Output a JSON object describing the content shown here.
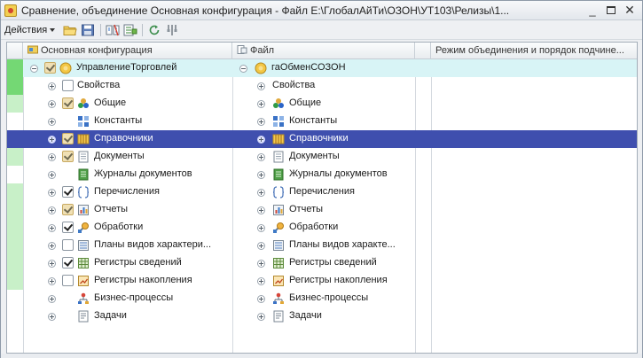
{
  "window": {
    "title": "Сравнение, объединение Основная конфигурация - Файл E:\\ГлобалАйТи\\ОЗОН\\УТ103\\Релизы\\1...",
    "minimize_label": "_",
    "close_label": "✕"
  },
  "toolbar": {
    "actions_label": "Действия",
    "icons": [
      "folder-open-icon",
      "save-icon",
      "compare-icon",
      "filter-icon",
      "refresh-icon",
      "settings-icon"
    ]
  },
  "columns": {
    "main": "Основная конфигурация",
    "file": "Файл",
    "mode": "Режим объединения и порядок подчине..."
  },
  "colors": {
    "selection": "#3f4fae",
    "root_row": "#d8f4f6",
    "changed_marker": "#74d874"
  },
  "rows": [
    {
      "left": "УправлениеТорговлей",
      "right": "гаОбменСОЗОН",
      "icon": "config-root-icon",
      "check": "gray",
      "marker": "strong",
      "level": 0,
      "expander": "minus"
    },
    {
      "left": "Свойства",
      "right": "Свойства",
      "icon": "",
      "check": "off",
      "marker": "strong",
      "level": 1,
      "expander": "plus"
    },
    {
      "left": "Общие",
      "right": "Общие",
      "icon": "common-icon",
      "check": "gray",
      "marker": "light",
      "level": 1,
      "expander": "plus"
    },
    {
      "left": "Константы",
      "right": "Константы",
      "icon": "constants-icon",
      "check": "none",
      "marker": "none",
      "level": 1,
      "expander": "plus"
    },
    {
      "left": "Справочники",
      "right": "Справочники",
      "icon": "catalogs-icon",
      "check": "gray",
      "marker": "none",
      "level": 1,
      "expander": "plus",
      "selected": true
    },
    {
      "left": "Документы",
      "right": "Документы",
      "icon": "documents-icon",
      "check": "gray",
      "marker": "light",
      "level": 1,
      "expander": "plus"
    },
    {
      "left": "Журналы документов",
      "right": "Журналы документов",
      "icon": "journals-icon",
      "check": "none",
      "marker": "none",
      "level": 1,
      "expander": "plus"
    },
    {
      "left": "Перечисления",
      "right": "Перечисления",
      "icon": "enums-icon",
      "check": "on",
      "marker": "light",
      "level": 1,
      "expander": "plus"
    },
    {
      "left": "Отчеты",
      "right": "Отчеты",
      "icon": "reports-icon",
      "check": "gray",
      "marker": "light",
      "level": 1,
      "expander": "plus"
    },
    {
      "left": "Обработки",
      "right": "Обработки",
      "icon": "processing-icon",
      "check": "on",
      "marker": "light",
      "level": 1,
      "expander": "plus"
    },
    {
      "left": "Планы видов характери...",
      "right": "Планы видов характе...",
      "icon": "chart-types-icon",
      "check": "off",
      "marker": "light",
      "level": 1,
      "expander": "plus"
    },
    {
      "left": "Регистры сведений",
      "right": "Регистры сведений",
      "icon": "info-registers-icon",
      "check": "on",
      "marker": "light",
      "level": 1,
      "expander": "plus"
    },
    {
      "left": "Регистры накопления",
      "right": "Регистры накопления",
      "icon": "accum-registers-icon",
      "check": "off",
      "marker": "light",
      "level": 1,
      "expander": "plus"
    },
    {
      "left": "Бизнес-процессы",
      "right": "Бизнес-процессы",
      "icon": "business-process-icon",
      "check": "none",
      "marker": "none",
      "level": 1,
      "expander": "plus"
    },
    {
      "left": "Задачи",
      "right": "Задачи",
      "icon": "tasks-icon",
      "check": "none",
      "marker": "none",
      "level": 1,
      "expander": "plus"
    }
  ]
}
